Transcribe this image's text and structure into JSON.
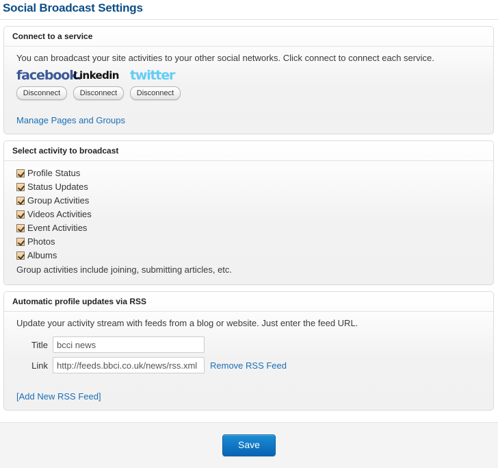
{
  "page": {
    "title": "Social Broadcast Settings"
  },
  "connect_section": {
    "header": "Connect to a service",
    "description": "You can broadcast your site activities to your other social networks. Click connect to connect each service.",
    "services": [
      {
        "name": "facebook",
        "logo_text": "facebook",
        "button_label": "Disconnect"
      },
      {
        "name": "linkedin",
        "logo_text": "Linked",
        "logo_badge": "in",
        "button_label": "Disconnect"
      },
      {
        "name": "twitter",
        "logo_text": "twitter",
        "button_label": "Disconnect"
      }
    ],
    "manage_link": "Manage Pages and Groups"
  },
  "activity_section": {
    "header": "Select activity to broadcast",
    "items": [
      {
        "label": "Profile Status",
        "checked": true
      },
      {
        "label": "Status Updates",
        "checked": true
      },
      {
        "label": "Group Activities",
        "checked": true
      },
      {
        "label": "Videos Activities",
        "checked": true
      },
      {
        "label": "Event Activities",
        "checked": true
      },
      {
        "label": "Photos",
        "checked": true
      },
      {
        "label": "Albums",
        "checked": true
      }
    ],
    "note": "Group activities include joining, submitting articles, etc."
  },
  "rss_section": {
    "header": "Automatic profile updates via RSS",
    "description": "Update your activity stream with feeds from a blog or website. Just enter the feed URL.",
    "title_label": "Title",
    "title_value": "bcci news",
    "title_placeholder": "",
    "link_label": "Link",
    "link_value": "http://feeds.bbci.co.uk/news/rss.xml",
    "link_placeholder": "",
    "remove_link": "Remove RSS Feed",
    "add_link": "[Add New RSS Feed]"
  },
  "footer": {
    "save_label": "Save"
  },
  "colors": {
    "title_blue": "#0b4d87",
    "link_blue": "#1a6fb5",
    "save_blue": "#1279c6",
    "facebook_blue": "#3b5998",
    "linkedin_blue": "#2a7fb5",
    "twitter_blue": "#62cdf6",
    "checkbox_fill": "#f3c189",
    "panel_bg": "#f2f2f2"
  }
}
